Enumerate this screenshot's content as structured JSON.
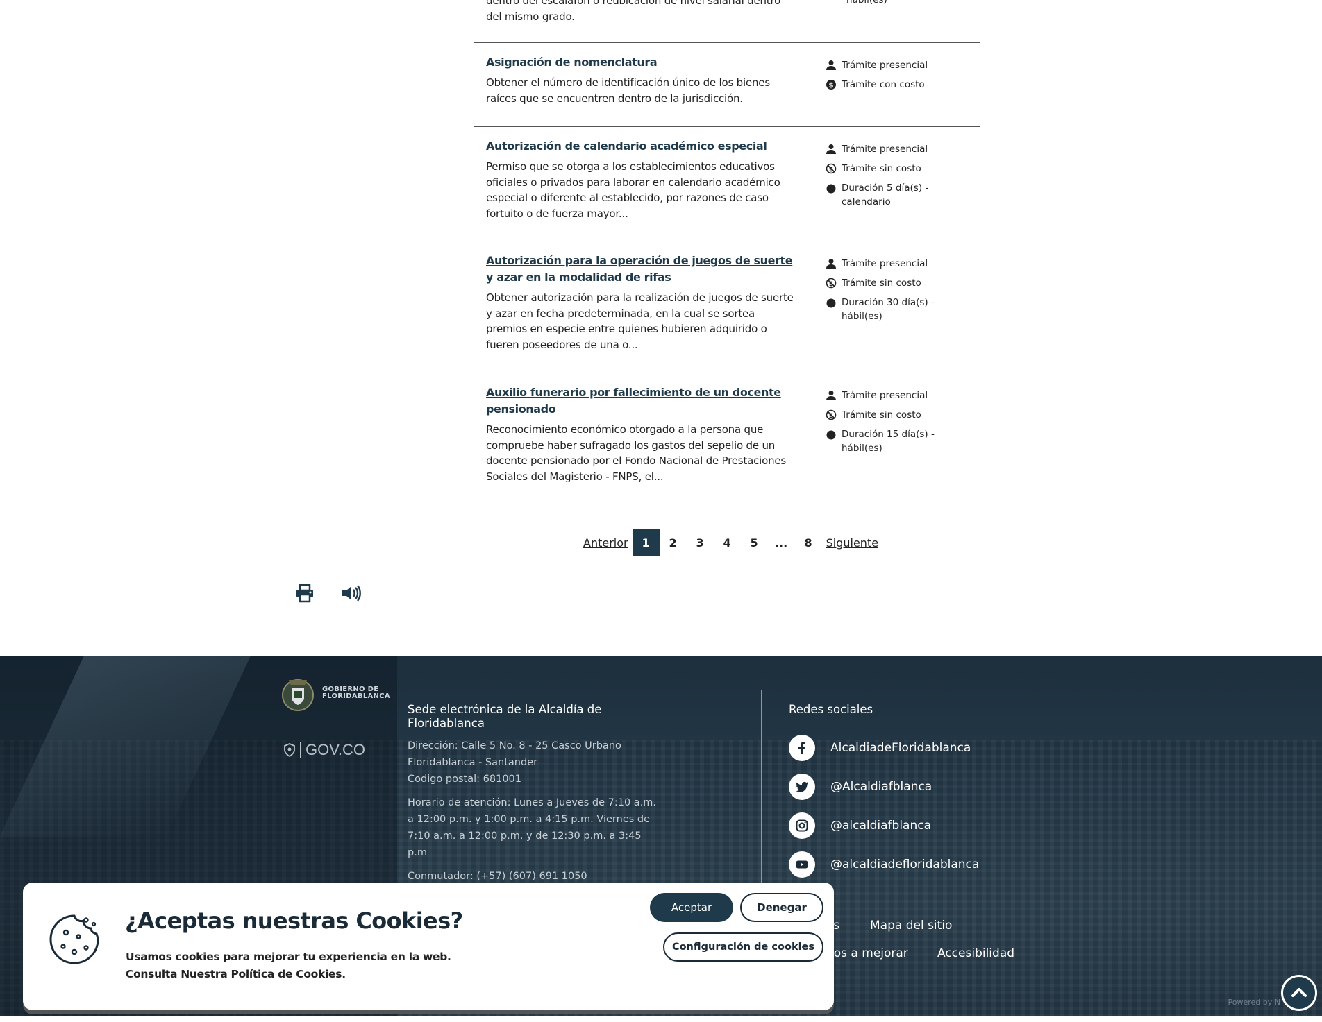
{
  "procedures": [
    {
      "title": "",
      "description": "dentro del escalafón o reubicación de nivel salarial dentro del mismo grado.",
      "meta": [
        {
          "icon": "clock-icon",
          "text": "hábil(es)"
        }
      ]
    },
    {
      "title": "Asignación de nomenclatura",
      "description": "Obtener el número de identificación único de los bienes raíces que se encuentren dentro de la jurisdicción.",
      "meta": [
        {
          "icon": "person-icon",
          "text": "Trámite presencial"
        },
        {
          "icon": "cost-icon",
          "text": "Trámite con costo"
        }
      ]
    },
    {
      "title": "Autorización de calendario académico especial",
      "description": "Permiso que se otorga a los establecimientos educativos oficiales o privados para laborar en calendario académico especial o diferente al establecido, por razones de caso fortuito o de fuerza mayor...",
      "meta": [
        {
          "icon": "person-icon",
          "text": "Trámite presencial"
        },
        {
          "icon": "no-cost-icon",
          "text": "Trámite sin costo"
        },
        {
          "icon": "clock-icon",
          "text": "Duración 5 día(s) - calendario"
        }
      ]
    },
    {
      "title": "Autorización para la operación de juegos de suerte y azar en la modalidad de rifas",
      "description": "Obtener autorización para la realización de juegos de suerte y azar en fecha predeterminada, en la cual se sortea premios en especie entre quienes hubieren adquirido o fueren poseedores de una o...",
      "meta": [
        {
          "icon": "person-icon",
          "text": "Trámite presencial"
        },
        {
          "icon": "no-cost-icon",
          "text": "Trámite sin costo"
        },
        {
          "icon": "clock-icon",
          "text": "Duración 30 día(s) - hábil(es)"
        }
      ]
    },
    {
      "title": "Auxilio funerario por fallecimiento de un docente pensionado",
      "description": "Reconocimiento económico otorgado a la persona que compruebe haber sufragado los gastos del sepelio de un docente pensionado por el Fondo Nacional de Prestaciones Sociales del Magisterio - FNPS, el...",
      "meta": [
        {
          "icon": "person-icon",
          "text": "Trámite presencial"
        },
        {
          "icon": "no-cost-icon",
          "text": "Trámite sin costo"
        },
        {
          "icon": "clock-icon",
          "text": "Duración 15 día(s) - hábil(es)"
        }
      ]
    }
  ],
  "pagination": {
    "prev": "Anterior",
    "pages": [
      "1",
      "2",
      "3",
      "4",
      "5",
      "...",
      "8"
    ],
    "current": "1",
    "next": "Siguiente"
  },
  "tools": {
    "print_icon": "print-icon",
    "audio_icon": "speaker-icon"
  },
  "footer": {
    "logo_text_1": "GOBIERNO DE",
    "logo_text_2": "FLORIDABLANCA",
    "gov_co": "GOV.CO",
    "sede_title": "Sede electrónica de la Alcaldía de Floridablanca",
    "address": "Dirección: Calle 5 No. 8 - 25 Casco Urbano Floridablanca - Santander",
    "postal": "Codigo postal: 681001",
    "hours": "Horario de atención: Lunes a Jueves de 7:10 a.m. a 12:00 p.m. y 1:00 p.m. a 4:15 p.m. Viernes de 7:10 a.m. a 12:00 p.m. y de 12:30 p.m. a 3:45 p.m",
    "phone": "Conmutador: (+57) (607) 691 1050",
    "social_title": "Redes sociales",
    "social": [
      {
        "icon": "facebook-icon",
        "label": "AlcaldiadeFloridablanca"
      },
      {
        "icon": "twitter-icon",
        "label": "@Alcaldiafblanca"
      },
      {
        "icon": "instagram-icon",
        "label": "@alcaldiafblanca"
      },
      {
        "icon": "youtube-icon",
        "label": "@alcaldiadefloridablanca"
      }
    ],
    "link_partial_1": "as",
    "link_sitemap": "Mapa del sitio",
    "link_partial_2": "nos a mejorar",
    "link_accessibility": "Accesibilidad",
    "powered": "Powered by N"
  },
  "cookie": {
    "title": "¿Aceptas nuestras Cookies?",
    "line1": "Usamos cookies para mejorar tu experiencia en la web.",
    "line2": "Consulta Nuestra Política de Cookies.",
    "accept": "Aceptar",
    "deny": "Denegar",
    "config": "Configuración de cookies"
  },
  "colors": {
    "primary": "#1f3a4a",
    "footer_bg": "#243847"
  }
}
